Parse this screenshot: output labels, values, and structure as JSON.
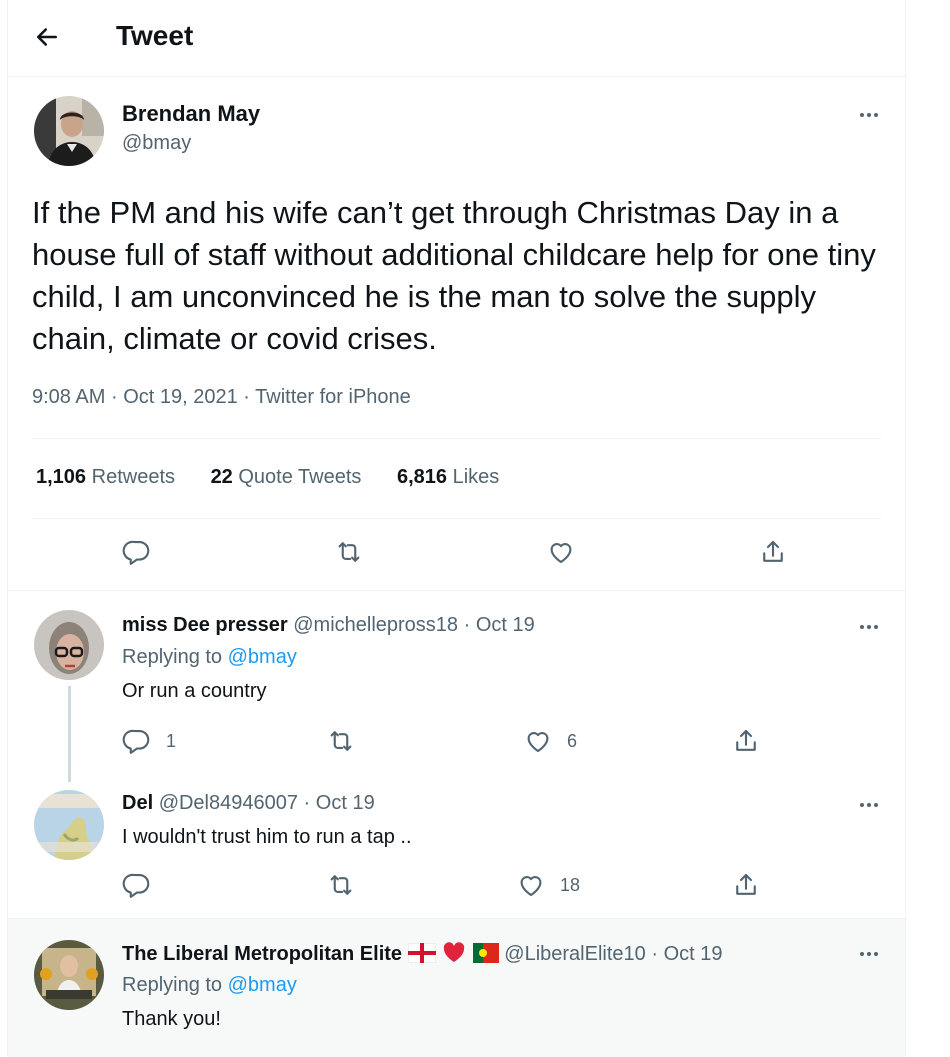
{
  "header": {
    "title": "Tweet"
  },
  "tweet": {
    "author_name": "Brendan May",
    "author_handle": "@bmay",
    "text": "If the PM and his wife can’t get through Christmas Day in a house full of staff without additional childcare help for one tiny child, I am unconvinced he is the man to solve the supply chain, climate or covid crises.",
    "time": "9:08 AM",
    "date": "Oct 19, 2021",
    "source": "Twitter for iPhone",
    "separator": "·",
    "retweets_count": "1,106",
    "retweets_label": "Retweets",
    "quotes_count": "22",
    "quotes_label": "Quote Tweets",
    "likes_count": "6,816",
    "likes_label": "Likes"
  },
  "replies": [
    {
      "name": "miss Dee presser",
      "handle": "@michellepross18",
      "date": "Oct 19",
      "replying_prefix": "Replying to",
      "replying_to": "@bmay",
      "text": "Or run a country",
      "reply_count": "1",
      "like_count": "6"
    },
    {
      "name": "Del",
      "handle": "@Del84946007",
      "date": "Oct 19",
      "text": "I wouldn't trust him to run a tap ..",
      "like_count": "18"
    },
    {
      "name": "The Liberal Metropolitan Elite",
      "handle": "@LiberalElite10",
      "date": "Oct 19",
      "replying_prefix": "Replying to",
      "replying_to": "@bmay",
      "text": "Thank you!"
    }
  ],
  "icons": {
    "back": "arrow-left-icon",
    "reply": "reply-icon",
    "retweet": "retweet-icon",
    "like": "heart-icon",
    "share": "share-icon",
    "more": "more-icon"
  },
  "colors": {
    "link": "#1d9bf0",
    "muted": "#536471",
    "text": "#0f1419",
    "border": "#eff3f4"
  }
}
